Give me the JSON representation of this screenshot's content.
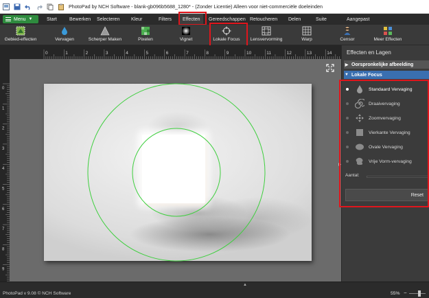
{
  "window": {
    "title": "PhotoPad by NCH Software - blank-gb096b5688_1280* - (Zonder Licentie) Alleen voor niet-commerciële doeleinden"
  },
  "menubar": {
    "menu_label": "Menu",
    "tabs": [
      "Start",
      "Bewerken",
      "Selecteren",
      "Kleur",
      "Filters",
      "Effecten",
      "Gereedschappen",
      "Retoucheren",
      "Delen",
      "Suite",
      "Aangepast"
    ],
    "active_tab": "Effecten"
  },
  "toolbar": {
    "items": [
      {
        "label": "Gebied-effecten",
        "icon": "area-effects-icon"
      },
      {
        "label": "Vervagen",
        "icon": "blur-drop-icon"
      },
      {
        "label": "Scherper Maken",
        "icon": "sharpen-triangle-icon"
      },
      {
        "label": "Pixelen",
        "icon": "pixelate-icon"
      },
      {
        "label": "Vignet",
        "icon": "vignette-icon"
      },
      {
        "label": "Lokale Focus",
        "icon": "focus-crosshair-icon"
      },
      {
        "label": "Lensvervorming",
        "icon": "lens-grid-icon"
      },
      {
        "label": "Warp",
        "icon": "warp-grid-icon"
      },
      {
        "label": "Censor",
        "icon": "censor-person-icon"
      },
      {
        "label": "Meer Effecten",
        "icon": "more-effects-icon"
      }
    ]
  },
  "rulers": {
    "top_ticks": [
      "0",
      "1",
      "2",
      "3",
      "4",
      "5",
      "6",
      "7",
      "8",
      "9",
      "10",
      "11",
      "12",
      "13",
      "14"
    ],
    "left_ticks": [
      "0",
      "1",
      "2",
      "3",
      "4",
      "5",
      "6",
      "7",
      "8",
      "9"
    ]
  },
  "panel": {
    "title": "Effecten en Lagen",
    "section_collapsed": "Oorspronkelijke afbeelding",
    "section_expanded": "Lokale Focus",
    "options": [
      {
        "label": "Standaard Vervaging",
        "icon": "drop-icon",
        "selected": true
      },
      {
        "label": "Draaivervaging",
        "icon": "spiral-icon",
        "selected": false
      },
      {
        "label": "Zoomvervaging",
        "icon": "zoom-arrows-icon",
        "selected": false
      },
      {
        "label": "Vierkante Vervaging",
        "icon": "square-icon",
        "selected": false
      },
      {
        "label": "Ovale Vervaging",
        "icon": "oval-icon",
        "selected": false
      },
      {
        "label": "Vrije Vorm-vervaging",
        "icon": "freeform-icon",
        "selected": false
      }
    ],
    "amount_label": "Aantal:",
    "reset_label": "Reset"
  },
  "statusbar": {
    "version": "PhotoPad v 9.08 © NCH Software",
    "zoom": "55%"
  },
  "colors": {
    "highlight": "#e0151c",
    "menu_green": "#2e8b3e",
    "section_blue": "#3a6fb0",
    "focus_circle": "#3ecf3e"
  }
}
